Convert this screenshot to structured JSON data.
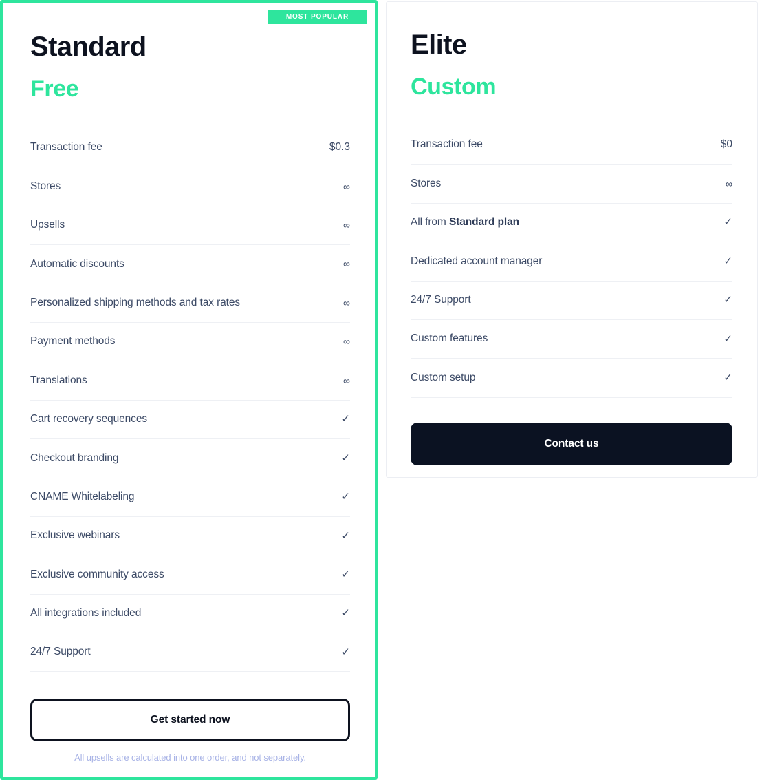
{
  "colors": {
    "accent_green": "#2ee59d",
    "heading_navy": "#0d121f",
    "feature_text": "#3c4a66",
    "divider": "#eef0f4",
    "disclaimer": "#a8b3e6",
    "solid_button_bg": "#0b1222",
    "plain_card_border": "#eceef3"
  },
  "plans": [
    {
      "id": "standard",
      "badge": "MOST POPULAR",
      "name": "Standard",
      "price": "Free",
      "features": [
        {
          "label": "Transaction fee",
          "value": "$0.3",
          "value_type": "text"
        },
        {
          "label": "Stores",
          "value": "∞",
          "value_type": "infinity"
        },
        {
          "label": "Upsells",
          "value": "∞",
          "value_type": "infinity"
        },
        {
          "label": "Automatic discounts",
          "value": "∞",
          "value_type": "infinity"
        },
        {
          "label": "Personalized shipping methods and tax rates",
          "value": "∞",
          "value_type": "infinity"
        },
        {
          "label": "Payment methods",
          "value": "∞",
          "value_type": "infinity"
        },
        {
          "label": "Translations",
          "value": "∞",
          "value_type": "infinity"
        },
        {
          "label": "Cart recovery sequences",
          "value": "✓",
          "value_type": "check"
        },
        {
          "label": "Checkout branding",
          "value": "✓",
          "value_type": "check"
        },
        {
          "label": "CNAME Whitelabeling",
          "value": "✓",
          "value_type": "check"
        },
        {
          "label": "Exclusive webinars",
          "value": "✓",
          "value_type": "check"
        },
        {
          "label": "Exclusive community access",
          "value": "✓",
          "value_type": "check"
        },
        {
          "label": "All integrations included",
          "value": "✓",
          "value_type": "check"
        },
        {
          "label": "24/7 Support",
          "value": "✓",
          "value_type": "check"
        }
      ],
      "cta_label": "Get started now",
      "disclaimer": "All upsells are calculated into one order, and not separately."
    },
    {
      "id": "elite",
      "name": "Elite",
      "price": "Custom",
      "features": [
        {
          "label": "Transaction fee",
          "value": "$0",
          "value_type": "text"
        },
        {
          "label": "Stores",
          "value": "∞",
          "value_type": "infinity"
        },
        {
          "label_prefix": "All from ",
          "label_strong": "Standard plan",
          "label": "All from Standard plan",
          "value": "✓",
          "value_type": "check"
        },
        {
          "label": "Dedicated account manager",
          "value": "✓",
          "value_type": "check"
        },
        {
          "label": "24/7 Support",
          "value": "✓",
          "value_type": "check"
        },
        {
          "label": "Custom features",
          "value": "✓",
          "value_type": "check"
        },
        {
          "label": "Custom setup",
          "value": "✓",
          "value_type": "check"
        }
      ],
      "cta_label": "Contact us"
    }
  ]
}
